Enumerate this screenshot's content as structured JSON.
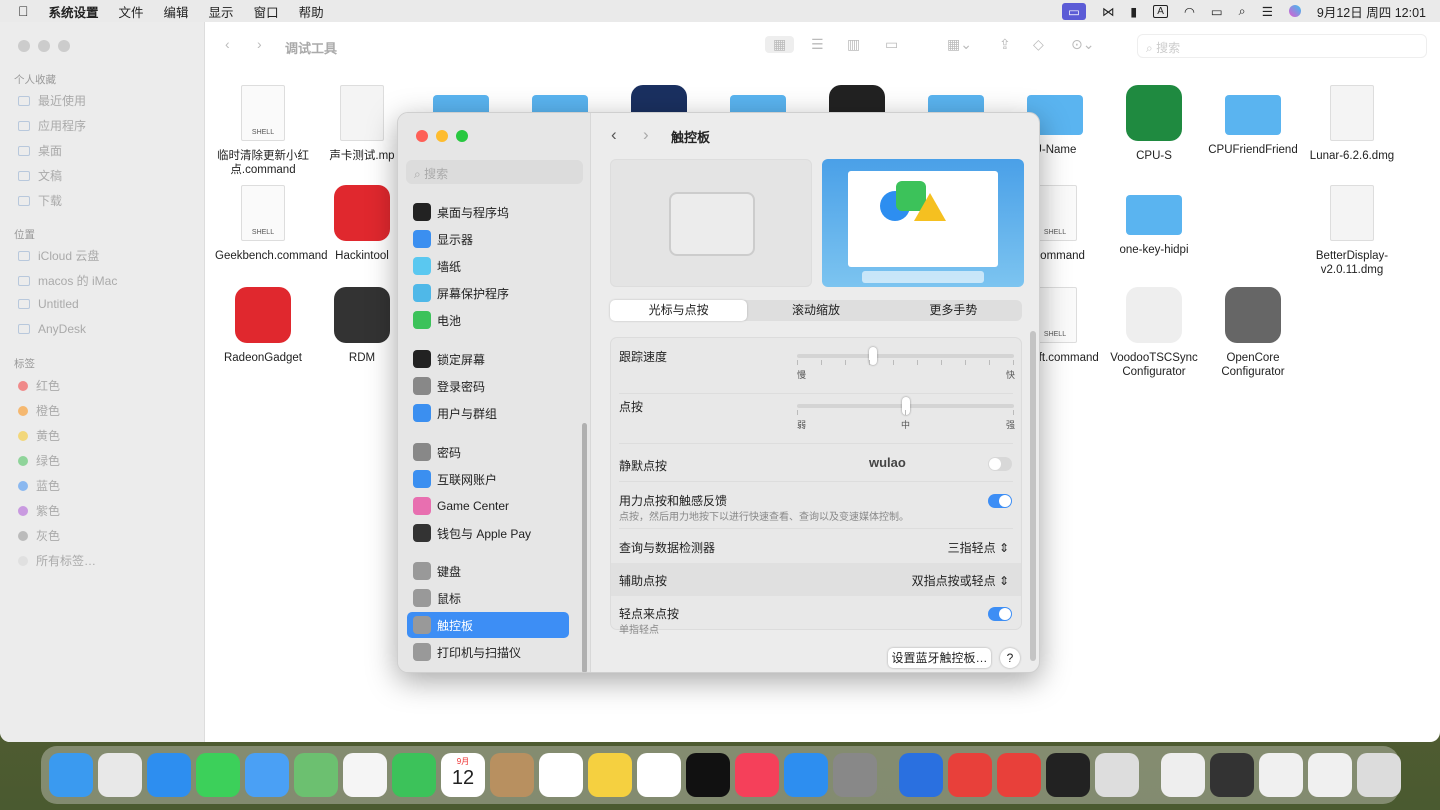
{
  "menubar": {
    "app": "系统设置",
    "menus": [
      "文件",
      "编辑",
      "显示",
      "窗口",
      "帮助"
    ],
    "clock": "9月12日 周四  12:01",
    "icons": [
      "screen-mirror-icon",
      "send-icon",
      "display-icon",
      "input-method-icon",
      "wifi-icon",
      "battery-icon",
      "spotlight-icon",
      "control-center-icon",
      "siri-icon"
    ],
    "input_label": "A"
  },
  "finder": {
    "title": "调试工具",
    "search_placeholder": "搜索",
    "sidebar": {
      "favorites_title": "个人收藏",
      "favorites": [
        "最近使用",
        "应用程序",
        "桌面",
        "文稿",
        "下载"
      ],
      "locations_title": "位置",
      "locations": [
        "iCloud 云盘",
        "macos 的 iMac",
        "Untitled",
        "AnyDesk"
      ],
      "tags_title": "标签",
      "tags": [
        {
          "label": "红色",
          "color": "#f08a8a"
        },
        {
          "label": "橙色",
          "color": "#f5b870"
        },
        {
          "label": "黄色",
          "color": "#f2d77a"
        },
        {
          "label": "绿色",
          "color": "#8fd49a"
        },
        {
          "label": "蓝色",
          "color": "#8ab8f0"
        },
        {
          "label": "紫色",
          "color": "#c99ae0"
        },
        {
          "label": "灰色",
          "color": "#bbbbbb"
        },
        {
          "label": "所有标签…",
          "color": "#e0e0e0"
        }
      ]
    },
    "files": [
      {
        "label": "临时清除更新小红点.command",
        "kind": "shell"
      },
      {
        "label": "声卡测试.mp",
        "kind": "audio"
      },
      {
        "label": "",
        "kind": "folder"
      },
      {
        "label": "",
        "kind": "folder"
      },
      {
        "label": "",
        "kind": "app"
      },
      {
        "label": "",
        "kind": "folder"
      },
      {
        "label": "",
        "kind": "app-dark"
      },
      {
        "label": "",
        "kind": "folder"
      },
      {
        "label": "U-Name",
        "kind": "folder"
      },
      {
        "label": "CPU-S",
        "kind": "app-green"
      },
      {
        "label": "CPUFriendFriend",
        "kind": "folder"
      },
      {
        "label": "Lunar-6.2.6.dmg",
        "kind": "dmg"
      },
      {
        "label": "Geekbench.command",
        "kind": "shell"
      },
      {
        "label": "Hackintool",
        "kind": "app-red"
      },
      {
        "label": "P.command",
        "kind": "shell",
        "col": 8
      },
      {
        "label": "one-key-hidpi",
        "kind": "folder"
      },
      {
        "label": "BetterDisplay-v2.0.11.dmg",
        "kind": "dmg",
        "col": 11
      },
      {
        "label": "RadeonGadget",
        "kind": "app-red"
      },
      {
        "label": "RDM",
        "kind": "monitor"
      },
      {
        "label": "geshift.command",
        "kind": "shell",
        "col": 8
      },
      {
        "label": "VoodooTSCSync Configurator",
        "kind": "kext"
      },
      {
        "label": "OpenCore Configurator",
        "kind": "app-gray"
      }
    ]
  },
  "settings": {
    "search_placeholder": "搜索",
    "title": "触控板",
    "sidebar": [
      {
        "label": "桌面与程序坞",
        "color": "#222"
      },
      {
        "label": "显示器",
        "color": "#3b8ff0"
      },
      {
        "label": "墙纸",
        "color": "#5ac8f0"
      },
      {
        "label": "屏幕保护程序",
        "color": "#4fb8e8"
      },
      {
        "label": "电池",
        "color": "#3cc25a"
      },
      {
        "label": "锁定屏幕",
        "color": "#222"
      },
      {
        "label": "登录密码",
        "color": "#888"
      },
      {
        "label": "用户与群组",
        "color": "#3b8ff0"
      },
      {
        "label": "密码",
        "color": "#888"
      },
      {
        "label": "互联网账户",
        "color": "#3b8ff0"
      },
      {
        "label": "Game Center",
        "color": "#e86fb0"
      },
      {
        "label": "钱包与 Apple Pay",
        "color": "#333"
      },
      {
        "label": "键盘",
        "color": "#999"
      },
      {
        "label": "鼠标",
        "color": "#999"
      },
      {
        "label": "触控板",
        "color": "#999",
        "selected": true
      },
      {
        "label": "打印机与扫描仪",
        "color": "#999"
      }
    ],
    "tabs": [
      "光标与点按",
      "滚动缩放",
      "更多手势"
    ],
    "active_tab": 0,
    "tracking": {
      "label": "跟踪速度",
      "min": "慢",
      "max": "快",
      "value_fraction": 0.35
    },
    "click": {
      "label": "点按",
      "min": "弱",
      "mid": "中",
      "max": "强",
      "value_fraction": 0.5
    },
    "silent": {
      "label": "静默点按",
      "on": false
    },
    "watermark": "wulao",
    "force": {
      "label": "用力点按和触感反馈",
      "desc": "点按，然后用力地按下以进行快速查看、查询以及变速媒体控制。",
      "on": true
    },
    "lookup": {
      "label": "查询与数据检测器",
      "value": "三指轻点"
    },
    "secondary": {
      "label": "辅助点按",
      "value": "双指点按或轻点"
    },
    "tap": {
      "label": "轻点来点按",
      "desc": "单指轻点",
      "on": true
    },
    "bt_button": "设置蓝牙触控板…",
    "help": "?",
    "accent": "#3d8ef5"
  },
  "dock": {
    "calendar_month": "9月",
    "calendar_day": "12",
    "apps": [
      {
        "name": "finder",
        "color": "#3a9af0"
      },
      {
        "name": "launchpad",
        "color": "#e8e8e8"
      },
      {
        "name": "safari",
        "color": "#2d8ef0"
      },
      {
        "name": "messages",
        "color": "#3cd05a"
      },
      {
        "name": "mail",
        "color": "#4aa0f5"
      },
      {
        "name": "maps",
        "color": "#6cc070"
      },
      {
        "name": "photos",
        "color": "#f5f5f5"
      },
      {
        "name": "facetime",
        "color": "#3cc25a"
      },
      {
        "name": "calendar",
        "color": "#ffffff"
      },
      {
        "name": "contacts",
        "color": "#b89060"
      },
      {
        "name": "reminders",
        "color": "#ffffff"
      },
      {
        "name": "notes",
        "color": "#f5d040"
      },
      {
        "name": "freeform",
        "color": "#ffffff"
      },
      {
        "name": "tv",
        "color": "#111111"
      },
      {
        "name": "music",
        "color": "#f5405a"
      },
      {
        "name": "app-store",
        "color": "#2d8ef0"
      },
      {
        "name": "system-settings",
        "color": "#888888"
      },
      {
        "name": "divider"
      },
      {
        "name": "remote-desktop",
        "color": "#2a70e0"
      },
      {
        "name": "anydesk",
        "color": "#e8403a"
      },
      {
        "name": "anydesk-2",
        "color": "#e8403a"
      },
      {
        "name": "terminal",
        "color": "#222222"
      },
      {
        "name": "disk-utility",
        "color": "#dddddd"
      },
      {
        "name": "divider"
      },
      {
        "name": "file",
        "color": "#eeeeee"
      },
      {
        "name": "screenshot-1",
        "color": "#333333"
      },
      {
        "name": "screenshot-2",
        "color": "#f0f0f0"
      },
      {
        "name": "screenshot-3",
        "color": "#f0f0f0"
      },
      {
        "name": "trash",
        "color": "#dcdcdc"
      }
    ]
  }
}
